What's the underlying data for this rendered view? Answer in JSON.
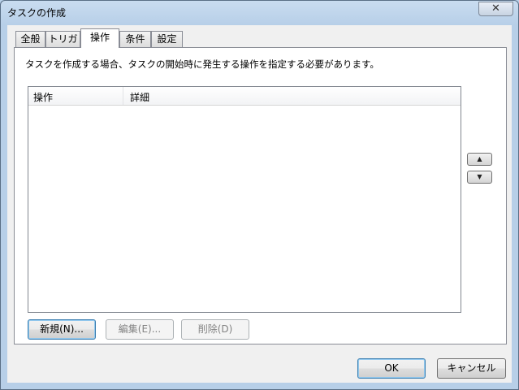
{
  "window": {
    "title": "タスクの作成",
    "close_glyph": "✕"
  },
  "tabs": [
    {
      "label": "全般",
      "active": false
    },
    {
      "label": "トリガ",
      "active": false
    },
    {
      "label": "操作",
      "active": true
    },
    {
      "label": "条件",
      "active": false
    },
    {
      "label": "設定",
      "active": false
    }
  ],
  "actions_page": {
    "description": "タスクを作成する場合、タスクの開始時に発生する操作を指定する必要があります。",
    "columns": [
      "操作",
      "詳細"
    ],
    "rows": [],
    "move_up_glyph": "▲",
    "move_down_glyph": "▼",
    "new_button": "新規(N)...",
    "edit_button": "編集(E)...",
    "delete_button": "削除(D)"
  },
  "footer": {
    "ok_button": "OK",
    "cancel_button": "キャンセル"
  }
}
